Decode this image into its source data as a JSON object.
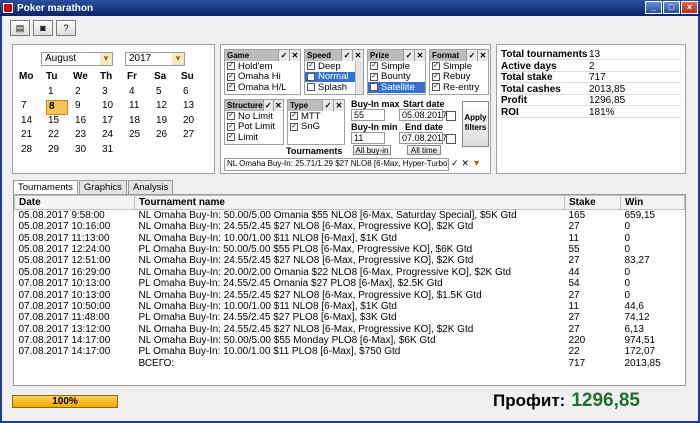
{
  "window": {
    "title": "Poker marathon"
  },
  "calendar": {
    "month": "August",
    "year": "2017",
    "weekdays": [
      "Mo",
      "Tu",
      "We",
      "Th",
      "Fr",
      "Sa",
      "Su"
    ],
    "days": [
      "",
      "1",
      "2",
      "3",
      "4",
      "5",
      "6",
      "7",
      "8",
      "9",
      "10",
      "11",
      "12",
      "13",
      "14",
      "15",
      "16",
      "17",
      "18",
      "19",
      "20",
      "21",
      "22",
      "23",
      "24",
      "25",
      "26",
      "27",
      "28",
      "29",
      "30",
      "31",
      "",
      "",
      ""
    ],
    "today": "8"
  },
  "filters": {
    "game": {
      "label": "Game",
      "items": [
        [
          "Hold'em",
          true
        ],
        [
          "Omaha Hi",
          true
        ],
        [
          "Omaha H/L",
          true
        ]
      ]
    },
    "speed": {
      "label": "Speed",
      "items": [
        [
          "Deep",
          true
        ],
        [
          "Normal",
          true
        ],
        [
          "Splash",
          false
        ]
      ]
    },
    "prize": {
      "label": "Prize",
      "items": [
        [
          "Simple",
          true
        ],
        [
          "Bounty",
          true
        ],
        [
          "Satellite",
          false
        ]
      ]
    },
    "format": {
      "label": "Format",
      "items": [
        [
          "Simple",
          true
        ],
        [
          "Rebuy",
          true
        ],
        [
          "Re-entry",
          true
        ]
      ]
    },
    "structure": {
      "label": "Structure",
      "items": [
        [
          "No Limit",
          true
        ],
        [
          "Pot Limit",
          true
        ],
        [
          "Limit",
          true
        ]
      ]
    },
    "type": {
      "label": "Type",
      "items": [
        [
          "MTT",
          true
        ],
        [
          "SnG",
          true
        ]
      ]
    },
    "buyin_max_label": "Buy-In max",
    "buyin_max": "55",
    "buyin_min_label": "Buy-In min",
    "buyin_min": "11",
    "all_buyin": "All buy-in",
    "start_date_label": "Start date",
    "start_date": "05.08.2017",
    "end_date_label": "End date",
    "end_date": "07.08.2017",
    "all_time": "All time",
    "apply": "Apply filters",
    "tournaments_label": "Tournaments",
    "tournament_value": "NL Omaha Buy-In: 25.71/1.29 $27 NLO8 [6-Max, Hyper-Turbo], $1K Gtd"
  },
  "stats": [
    [
      "Total tournaments",
      "13"
    ],
    [
      "Active days",
      "2"
    ],
    [
      "Total stake",
      "717"
    ],
    [
      "Total cashes",
      "2013,85"
    ],
    [
      "Profit",
      "1296,85"
    ],
    [
      "ROI",
      "181%"
    ]
  ],
  "tabs": [
    "Tournaments",
    "Graphics",
    "Analysis"
  ],
  "table": {
    "headers": [
      "Date",
      "Tournament name",
      "Stake",
      "Win"
    ],
    "rows": [
      [
        "05.08.2017 9:58:00",
        "NL Omaha Buy-In: 50.00/5.00 Omania $55 NLO8 [6-Max, Saturday Special], $5K Gtd",
        "165",
        "659,15"
      ],
      [
        "05.08.2017 10:16:00",
        "NL Omaha Buy-In: 24.55/2.45 $27 NLO8 [6-Max, Progressive KO], $2K Gtd",
        "27",
        "0"
      ],
      [
        "05.08.2017 11:13:00",
        "NL Omaha Buy-In: 10.00/1.00 $11 NLO8 [6-Max], $1K Gtd",
        "11",
        "0"
      ],
      [
        "05.08.2017 12:24:00",
        "PL Omaha Buy-In: 50.00/5.00 $55 PLO8 [6-Max, Progressive KO], $6K Gtd",
        "55",
        "0"
      ],
      [
        "05.08.2017 12:51:00",
        "NL Omaha Buy-In: 24.55/2.45 $27 NLO8 [6-Max, Progressive KO], $2K Gtd",
        "27",
        "83,27"
      ],
      [
        "05.08.2017 16:29:00",
        "NL Omaha Buy-In: 20.00/2.00 Omania $22 NLO8 [6-Max, Progressive KO], $2K Gtd",
        "44",
        "0"
      ],
      [
        "07.08.2017 10:13:00",
        "PL Omaha Buy-In: 24.55/2.45 Omania $27 PLO8 [6-Max], $2.5K Gtd",
        "54",
        "0"
      ],
      [
        "07.08.2017 10:13:00",
        "NL Omaha Buy-In: 24.55/2.45 $27 NLO8 [6-Max, Progressive KO], $1.5K Gtd",
        "27",
        "0"
      ],
      [
        "07.08.2017 10:50:00",
        "NL Omaha Buy-In: 10.00/1.00 $11 NLO8 [6-Max], $1K Gtd",
        "11",
        "44,6"
      ],
      [
        "07.08.2017 11:48:00",
        "PL Omaha Buy-In: 24.55/2.45 $27 PLO8 [6-Max], $3K Gtd",
        "27",
        "74,12"
      ],
      [
        "07.08.2017 13:12:00",
        "NL Omaha Buy-In: 24.55/2.45 $27 NLO8 [6-Max, Progressive KO], $2K Gtd",
        "27",
        "6,13"
      ],
      [
        "07.08.2017 14:17:00",
        "NL Omaha Buy-In: 50.00/5.00 $55 Monday PLO8 [6-Max], $6K Gtd",
        "220",
        "974,51"
      ],
      [
        "07.08.2017 14:17:00",
        "PL Omaha Buy-In: 10.00/1.00 $11 PLO8 [6-Max], $750 Gtd",
        "22",
        "172,07"
      ],
      [
        "",
        "ВСЕГО:",
        "717",
        "2013,85"
      ]
    ]
  },
  "progress": {
    "label": "100%",
    "fraction": 1.0
  },
  "profit": {
    "label": "Профит:",
    "value": "1296,85"
  },
  "colors": {
    "accent": "#3571d1",
    "profit": "#1f6f2a",
    "progress": "#f2a800"
  }
}
